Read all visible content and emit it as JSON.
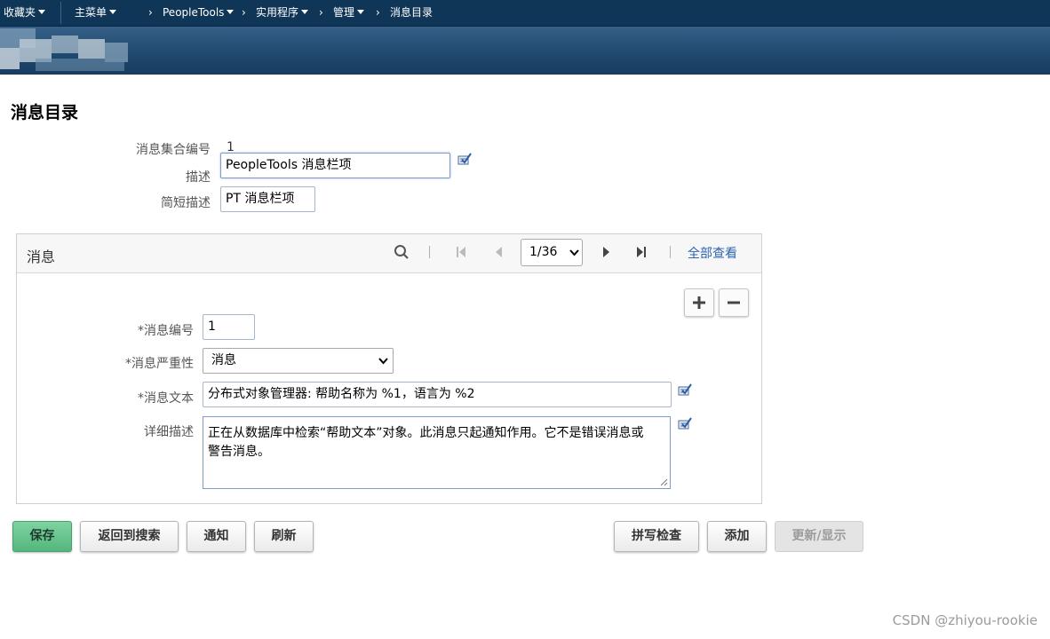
{
  "nav": {
    "favorites": "收藏夹",
    "main_menu": "主菜单",
    "crumbs": [
      "PeopleTools",
      "实用程序",
      "管理",
      "消息目录"
    ]
  },
  "page": {
    "title": "消息目录"
  },
  "form": {
    "set_number_label": "消息集合编号",
    "set_number_value": "1",
    "description_label": "描述",
    "description_value": "PeopleTools 消息栏项",
    "short_desc_label": "简短描述",
    "short_desc_value": "PT 消息栏项"
  },
  "grid": {
    "title": "消息",
    "pager_value": "1/36",
    "view_all": "全部查看",
    "fields": {
      "msg_number_label": "*消息编号",
      "msg_number_value": "1",
      "severity_label": "*消息严重性",
      "severity_value": "消息",
      "text_label": "*消息文本",
      "text_value": "分布式对象管理器: 帮助名称为 %1，语言为 %2",
      "detail_label": "详细描述",
      "detail_value_line1": "正在从数据库中检索“帮助文本”对象。此消息只起通知作用。它不是错误消息或",
      "detail_value_line2": "警告消息。"
    }
  },
  "buttons": {
    "save": "保存",
    "return_to_search": "返回到搜索",
    "notify": "通知",
    "refresh": "刷新",
    "spell_check": "拼写检查",
    "add": "添加",
    "update_display": "更新/显示"
  },
  "watermark": "CSDN @zhiyou-rookie",
  "colors": {
    "nav_bg": "#0f3557",
    "banner": "#214a70",
    "primary_button": "#54b77d",
    "link": "#2c64b0"
  },
  "icons": {
    "spell": "spell-check-icon",
    "search": "search-icon",
    "first": "first-page-icon",
    "prev": "previous-icon",
    "next": "next-icon",
    "last": "last-page-icon",
    "add_row": "plus-icon",
    "delete_row": "minus-icon"
  }
}
